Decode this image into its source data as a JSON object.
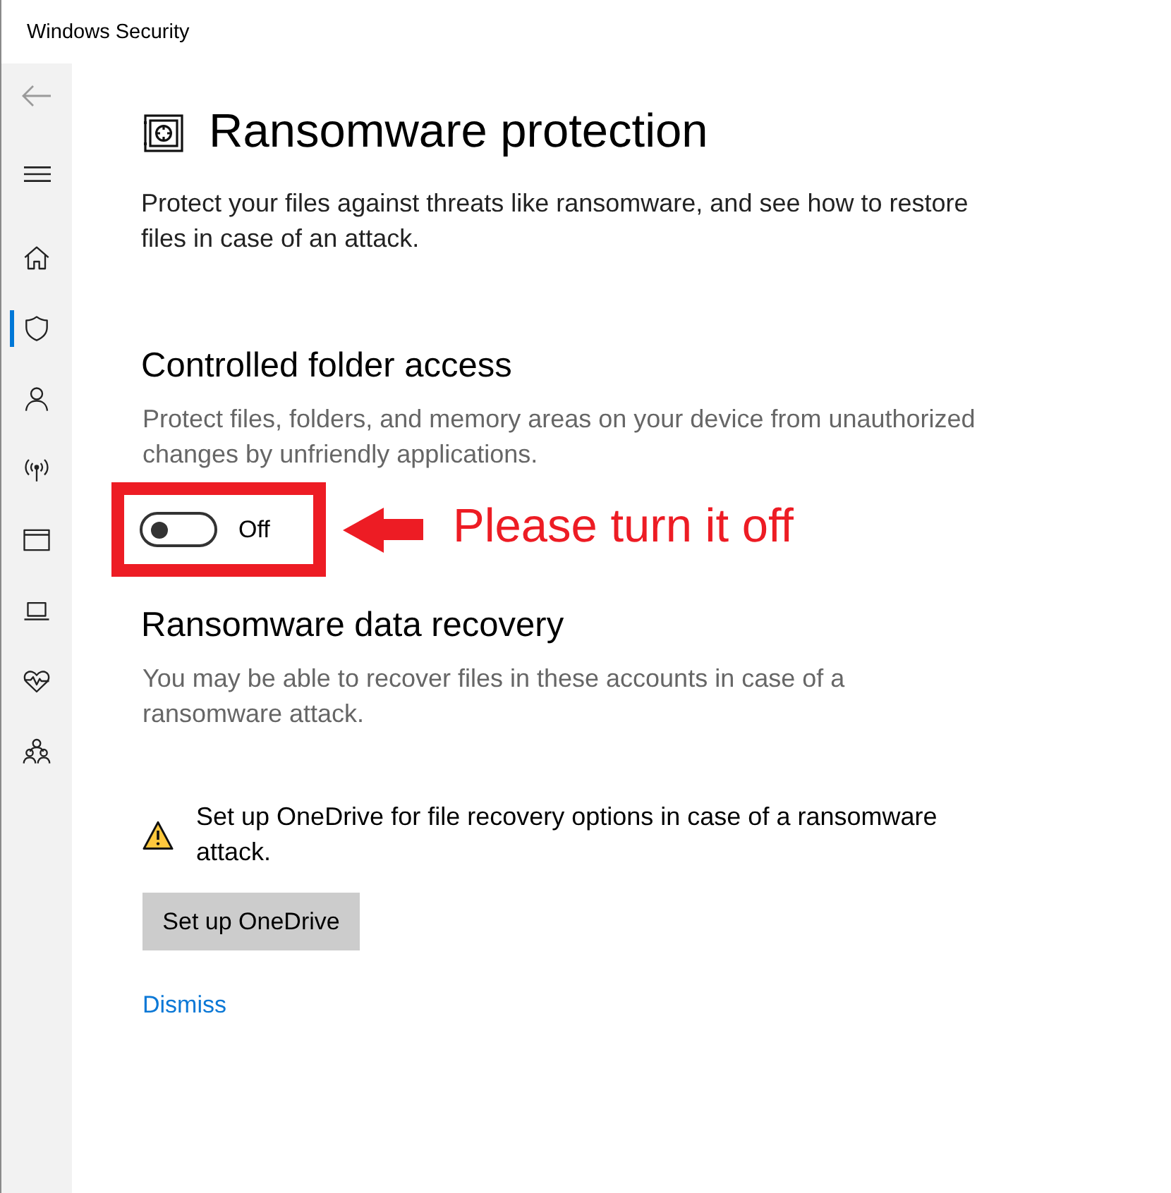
{
  "window": {
    "title": "Windows Security"
  },
  "sidebar": {
    "back_button": {
      "disabled": true
    },
    "items": [
      {
        "selected": false
      },
      {
        "selected": true
      },
      {
        "selected": false
      },
      {
        "selected": false
      },
      {
        "selected": false
      },
      {
        "selected": false
      },
      {
        "selected": false
      },
      {
        "selected": false
      }
    ]
  },
  "page": {
    "title": "Ransomware protection",
    "description": "Protect your files against threats like ransomware, and see how to restore files in case of an attack."
  },
  "controlled_folder_access": {
    "heading": "Controlled folder access",
    "description": "Protect files, folders, and memory areas on your device from unauthorized changes by unfriendly applications.",
    "toggle": {
      "on": false,
      "label": "Off"
    }
  },
  "annotation": {
    "text": "Please turn it off"
  },
  "data_recovery": {
    "heading": "Ransomware data recovery",
    "description": "You may be able to recover files in these accounts in case of a ransomware attack.",
    "warning": "Set up OneDrive for file recovery options in case of a ransomware attack.",
    "button": "Set up OneDrive",
    "link": "Dismiss"
  }
}
